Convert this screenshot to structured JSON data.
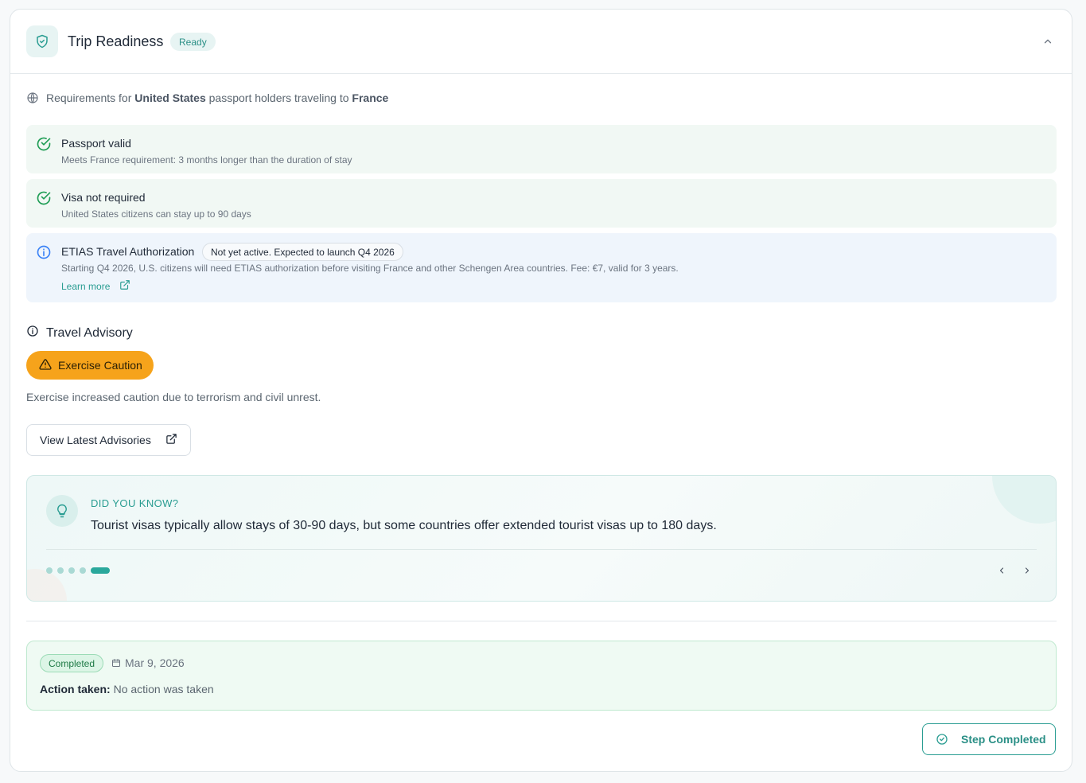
{
  "header": {
    "title": "Trip Readiness",
    "status_badge": "Ready"
  },
  "requirements_line": {
    "prefix": "Requirements for",
    "origin": "United States",
    "middle": "passport holders traveling to",
    "destination": "France"
  },
  "requirements": [
    {
      "title": "Passport valid",
      "description": "Meets France requirement: 3 months longer than the duration of stay",
      "status": "ok"
    },
    {
      "title": "Visa not required",
      "description": "United States citizens can stay up to 90 days",
      "status": "ok"
    },
    {
      "title": "ETIAS Travel Authorization",
      "badge": "Not yet active. Expected to launch Q4 2026",
      "description": "Starting Q4 2026, U.S. citizens will need ETIAS authorization before visiting France and other Schengen Area countries. Fee: €7, valid for 3 years.",
      "link": "Learn more",
      "status": "info"
    }
  ],
  "advisory": {
    "heading": "Travel Advisory",
    "level": "Exercise Caution",
    "description": "Exercise increased caution due to terrorism and civil unrest.",
    "button": "View Latest Advisories"
  },
  "tip": {
    "label": "DID YOU KNOW?",
    "text": "Tourist visas typically allow stays of 30-90 days, but some countries offer extended tourist visas up to 180 days.",
    "total_slides": 5,
    "active_slide": 5
  },
  "completion": {
    "badge": "Completed",
    "date": "Mar 9, 2026",
    "action_label": "Action taken:",
    "action_value": "No action was taken"
  },
  "footer": {
    "button": "Step Completed"
  },
  "colors": {
    "accent": "#2a9d92",
    "success": "#1f9d55",
    "info": "#3b82f6",
    "caution": "#f6a31b"
  }
}
